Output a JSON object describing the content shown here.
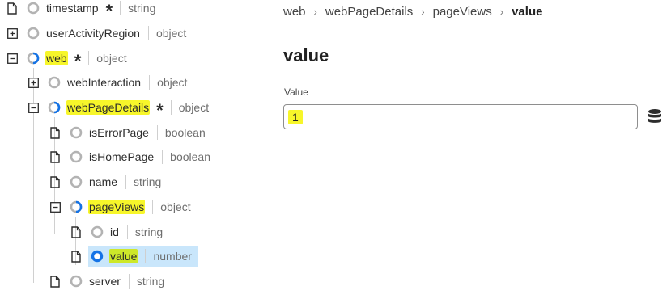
{
  "tree": {
    "rows": [
      {
        "name": "timestamp",
        "type": "string",
        "control": "leaf",
        "required": true,
        "radio": "empty",
        "highlight": "none"
      },
      {
        "name": "userActivityRegion",
        "type": "object",
        "control": "expand",
        "required": false,
        "radio": "empty",
        "highlight": "none"
      },
      {
        "name": "web",
        "type": "object",
        "control": "collapse",
        "required": true,
        "radio": "partial",
        "highlight": "yellow"
      },
      {
        "name": "webInteraction",
        "type": "object",
        "control": "expand",
        "required": false,
        "radio": "empty",
        "highlight": "none"
      },
      {
        "name": "webPageDetails",
        "type": "object",
        "control": "collapse",
        "required": true,
        "radio": "partial",
        "highlight": "yellow"
      },
      {
        "name": "isErrorPage",
        "type": "boolean",
        "control": "leaf",
        "required": false,
        "radio": "empty",
        "highlight": "none"
      },
      {
        "name": "isHomePage",
        "type": "boolean",
        "control": "leaf",
        "required": false,
        "radio": "empty",
        "highlight": "none"
      },
      {
        "name": "name",
        "type": "string",
        "control": "leaf",
        "required": false,
        "radio": "empty",
        "highlight": "none"
      },
      {
        "name": "pageViews",
        "type": "object",
        "control": "collapse",
        "required": false,
        "radio": "partial",
        "highlight": "yellow"
      },
      {
        "name": "id",
        "type": "string",
        "control": "leaf",
        "required": false,
        "radio": "empty",
        "highlight": "none"
      },
      {
        "name": "value",
        "type": "number",
        "control": "leaf",
        "required": false,
        "radio": "selected",
        "highlight": "green",
        "selected": true
      },
      {
        "name": "server",
        "type": "string",
        "control": "leaf",
        "required": false,
        "radio": "empty",
        "highlight": "none"
      }
    ],
    "required_marker": "*"
  },
  "breadcrumb": {
    "items": [
      "web",
      "webPageDetails",
      "pageViews"
    ],
    "current": "value",
    "separator": "›"
  },
  "detail": {
    "title": "value",
    "field_label": "Value",
    "field_value": "1"
  },
  "colors": {
    "highlight_yellow": "#f7f62a",
    "highlight_green": "#cde82a",
    "selection": "#c9e6fb",
    "radio_blue": "#1473e6",
    "radio_grey": "#b3b3b3"
  },
  "icons": {
    "leaf": "document-icon",
    "expand": "plus-box-icon",
    "collapse": "minus-box-icon",
    "datasource": "database-icon"
  }
}
